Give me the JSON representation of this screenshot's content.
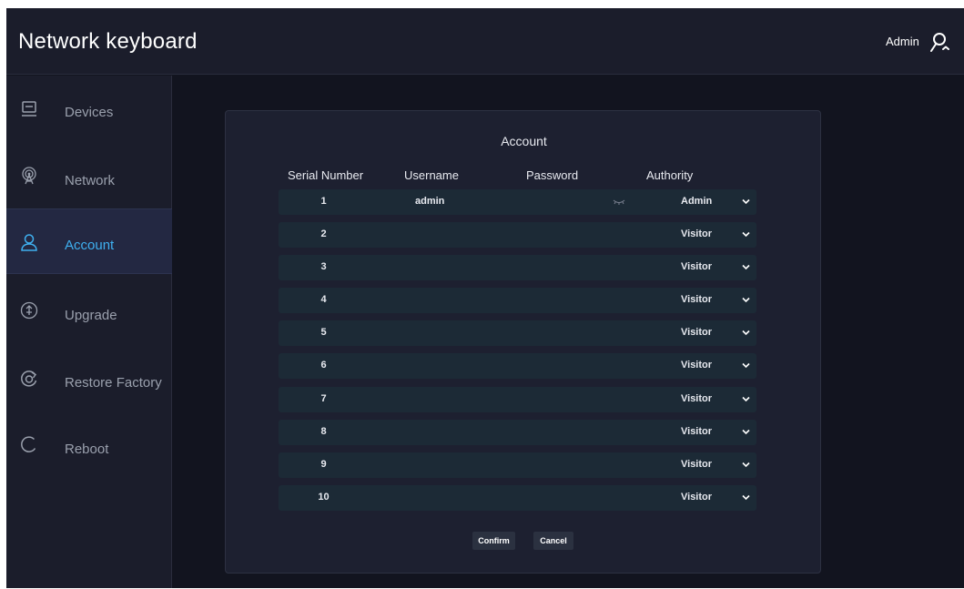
{
  "app": {
    "title": "Network keyboard",
    "user": "Admin"
  },
  "sidebar": {
    "items": [
      {
        "label": "Devices",
        "icon": "monitor-icon",
        "active": false
      },
      {
        "label": "Network",
        "icon": "wireless-icon",
        "active": false
      },
      {
        "label": "Account",
        "icon": "user-icon",
        "active": true
      },
      {
        "label": "Upgrade",
        "icon": "upgrade-icon",
        "active": false
      },
      {
        "label": "Restore Factory",
        "icon": "restore-icon",
        "active": false
      },
      {
        "label": "Reboot",
        "icon": "reboot-icon",
        "active": false
      }
    ]
  },
  "panel": {
    "title": "Account",
    "columns": {
      "serial": "Serial Number",
      "username": "Username",
      "password": "Password",
      "authority": "Authority"
    },
    "rows": [
      {
        "serial": "1",
        "username": "admin",
        "password_hidden": true,
        "authority": "Admin"
      },
      {
        "serial": "2",
        "username": "",
        "authority": "Visitor"
      },
      {
        "serial": "3",
        "username": "",
        "authority": "Visitor"
      },
      {
        "serial": "4",
        "username": "",
        "authority": "Visitor"
      },
      {
        "serial": "5",
        "username": "",
        "authority": "Visitor"
      },
      {
        "serial": "6",
        "username": "",
        "authority": "Visitor"
      },
      {
        "serial": "7",
        "username": "",
        "authority": "Visitor"
      },
      {
        "serial": "8",
        "username": "",
        "authority": "Visitor"
      },
      {
        "serial": "9",
        "username": "",
        "authority": "Visitor"
      },
      {
        "serial": "10",
        "username": "",
        "authority": "Visitor"
      }
    ],
    "confirm_label": "Confirm",
    "cancel_label": "Cancel"
  },
  "colors": {
    "accent": "#3fb0f0",
    "background": "#12141f",
    "panel": "#1d2030",
    "row": "#1c2a36",
    "sidebar": "#1b1d2b"
  }
}
